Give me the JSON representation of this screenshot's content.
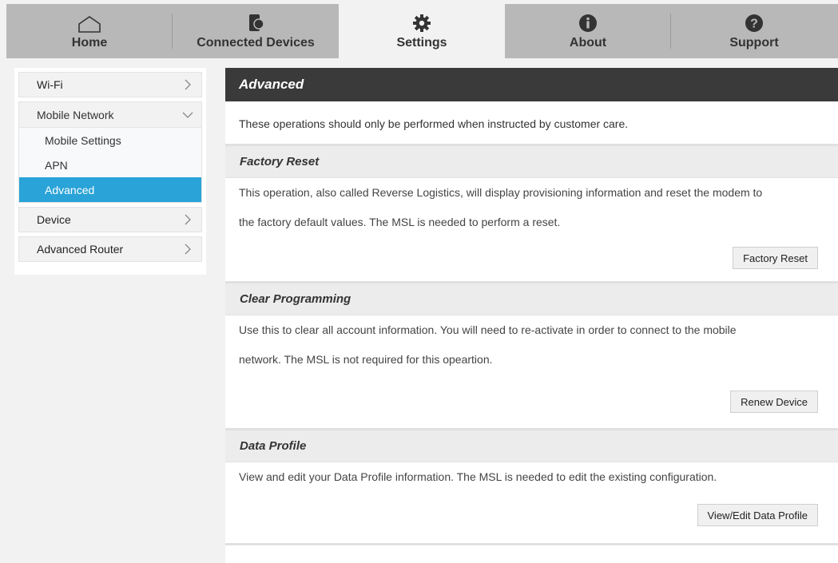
{
  "nav": {
    "tabs": [
      {
        "label": "Home",
        "icon": "home-icon"
      },
      {
        "label": "Connected Devices",
        "icon": "device-icon"
      },
      {
        "label": "Settings",
        "icon": "gear-icon"
      },
      {
        "label": "About",
        "icon": "info-icon"
      },
      {
        "label": "Support",
        "icon": "help-icon"
      }
    ],
    "active": "Settings"
  },
  "sidebar": {
    "wifi": "Wi-Fi",
    "mobile_network": "Mobile Network",
    "mobile_settings": "Mobile Settings",
    "apn": "APN",
    "advanced": "Advanced",
    "device": "Device",
    "advanced_router": "Advanced Router"
  },
  "main": {
    "title": "Advanced",
    "intro": "These operations should only be performed when instructed by customer care.",
    "sections": [
      {
        "title": "Factory Reset",
        "line1": "This operation, also called Reverse Logistics, will display provisioning information and reset the modem to",
        "line2": "the factory default values. The MSL is needed to perform a reset.",
        "button": "Factory Reset"
      },
      {
        "title": "Clear Programming",
        "line1": "Use this to clear all account information. You will need to re-activate in order to connect to the mobile",
        "line2": "network. The MSL is not required for this opeartion.",
        "button": "Renew Device"
      },
      {
        "title": "Data Profile",
        "line1": "View and edit your Data Profile information. The MSL is needed to edit the existing configuration.",
        "button": "View/Edit Data Profile"
      }
    ]
  },
  "colors": {
    "accent": "#2aa3d8",
    "title_bar": "#3a3a3a",
    "nav_bg": "#b8b8b8"
  }
}
